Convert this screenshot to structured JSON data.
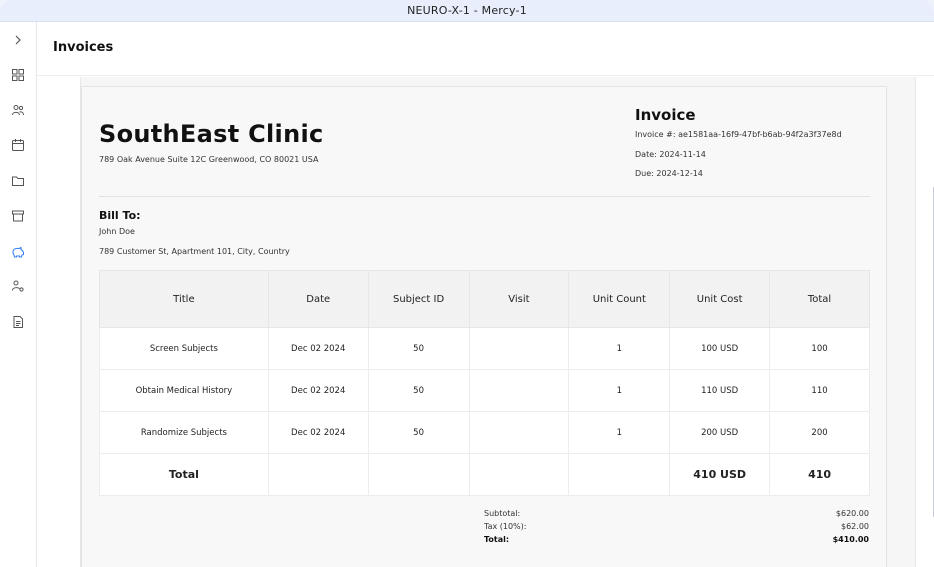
{
  "window": {
    "title": "NEURO-X-1 - Mercy-1"
  },
  "page": {
    "title": "Invoices"
  },
  "sidebar": {
    "items": [
      {
        "icon": "chevron-right-icon"
      },
      {
        "icon": "dashboard-icon"
      },
      {
        "icon": "users-icon"
      },
      {
        "icon": "calendar-icon"
      },
      {
        "icon": "folder-icon"
      },
      {
        "icon": "archive-icon"
      },
      {
        "icon": "piggy-bank-icon",
        "active": true
      },
      {
        "icon": "user-settings-icon"
      },
      {
        "icon": "document-icon"
      }
    ]
  },
  "invoice": {
    "clinic_name": "SouthEast Clinic",
    "clinic_address": "789 Oak Avenue Suite 12C Greenwood, CO 80021 USA",
    "heading": "Invoice",
    "number": "Invoice #: ae1581aa-16f9-47bf-b6ab-94f2a3f37e8d",
    "date": "Date: 2024-11-14",
    "due": "Due: 2024-12-14",
    "bill_to_label": "Bill To:",
    "bill_to_name": "John Doe",
    "bill_to_address": "789 Customer St, Apartment 101, City, Country"
  },
  "table": {
    "headers": [
      "Title",
      "Date",
      "Subject ID",
      "Visit",
      "Unit Count",
      "Unit Cost",
      "Total"
    ],
    "rows": [
      [
        "Screen Subjects",
        "Dec 02 2024",
        "50",
        "",
        "1",
        "100 USD",
        "100"
      ],
      [
        "Obtain Medical History",
        "Dec 02 2024",
        "50",
        "",
        "1",
        "110 USD",
        "110"
      ],
      [
        "Randomize Subjects",
        "Dec 02 2024",
        "50",
        "",
        "1",
        "200 USD",
        "200"
      ]
    ],
    "total_row": [
      "Total",
      "",
      "",
      "",
      "",
      "410 USD",
      "410"
    ]
  },
  "summary": {
    "subtotal_label": "Subtotal:",
    "subtotal_value": "$620.00",
    "tax_label": "Tax (10%):",
    "tax_value": "$62.00",
    "total_label": "Total:",
    "total_value": "$410.00"
  }
}
